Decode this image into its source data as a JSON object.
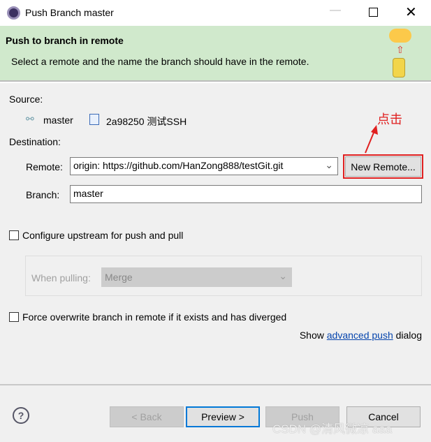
{
  "window": {
    "title": "Push Branch master"
  },
  "banner": {
    "title": "Push to branch in remote",
    "description": "Select a remote and the name the branch should have in the remote."
  },
  "source": {
    "label": "Source:",
    "branch": "master",
    "commit": "2a98250 测试SSH"
  },
  "destination": {
    "label": "Destination:",
    "remote_label": "Remote:",
    "remote_value": "origin: https://github.com/HanZong888/testGit.git",
    "new_remote": "New Remote...",
    "branch_label": "Branch:",
    "branch_value": "master"
  },
  "annotation": {
    "text": "点击",
    "color": "#e02020"
  },
  "upstream": {
    "label": "Configure upstream for push and pull",
    "when_pulling_label": "When pulling:",
    "when_pulling_value": "Merge"
  },
  "force": {
    "label": "Force overwrite branch in remote if it exists and has diverged"
  },
  "advanced": {
    "prefix": "Show",
    "link": "advanced push",
    "suffix": "dialog"
  },
  "footer": {
    "back": "< Back",
    "preview": "Preview >",
    "push": "Push",
    "cancel": "Cancel"
  },
  "watermark": "CSDN @清风微凉 aaa"
}
